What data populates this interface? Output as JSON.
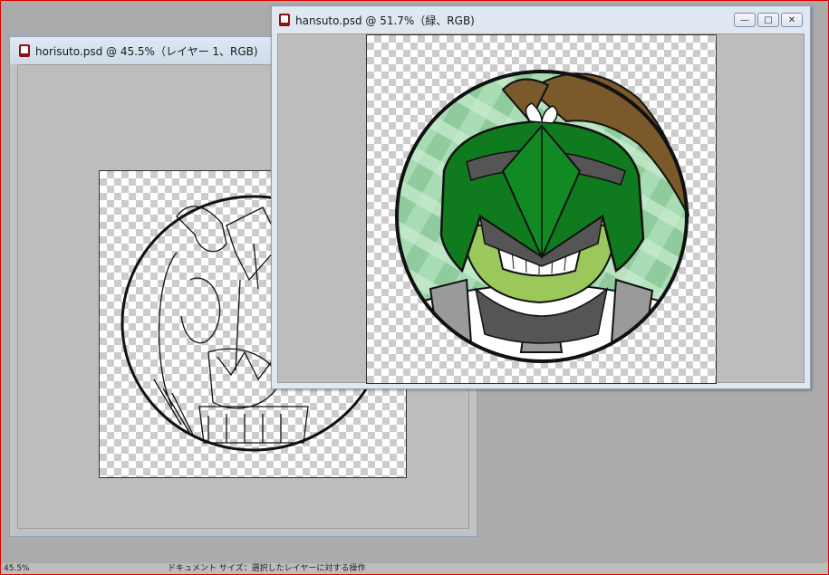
{
  "windows": {
    "back": {
      "title": "horisuto.psd @ 45.5%（レイヤー 1、RGB)"
    },
    "front": {
      "title": "hansuto.psd @ 51.7%（緑、RGB)",
      "controls": {
        "minimize": "—",
        "maximize": "□",
        "close": "✕"
      }
    }
  },
  "statusbar": {
    "zoom": "45.5%",
    "hint": "ドキュメント サイズ：選択したレイヤーに対する操作"
  },
  "colors": {
    "accent_green": "#0f7a1e",
    "frame_red": "#e00000",
    "workspace_gray": "#ababab"
  }
}
